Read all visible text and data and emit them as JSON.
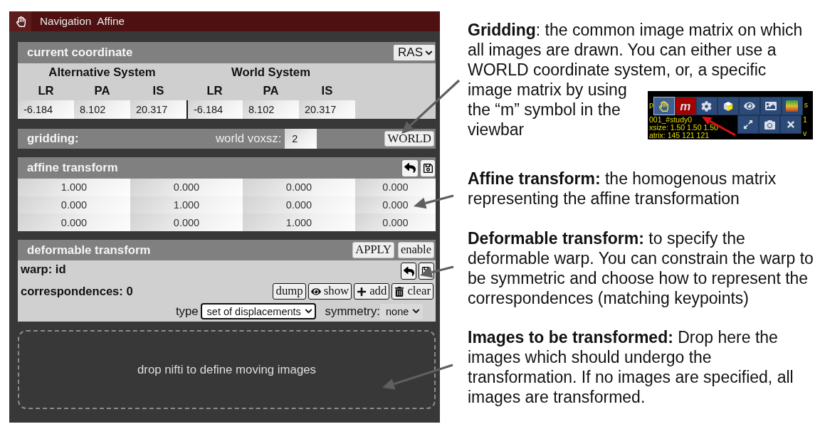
{
  "panel": {
    "tabs": [
      {
        "label": "Navigation"
      },
      {
        "label": "Affine"
      }
    ],
    "current_coordinate": {
      "title": "current coordinate",
      "orientation": "RAS",
      "groups": [
        "Alternative System",
        "World System"
      ],
      "axes": [
        "LR",
        "PA",
        "IS",
        "LR",
        "PA",
        "IS"
      ],
      "values": [
        "-6.184",
        "8.102",
        "20.317",
        "-6.184",
        "8.102",
        "20.317"
      ]
    },
    "gridding": {
      "title": "gridding:",
      "voxsz_label": "world voxsz:",
      "voxsz": "2",
      "button": "WORLD"
    },
    "affine_transform": {
      "title": "affine transform",
      "matrix": [
        [
          "1.000",
          "0.000",
          "0.000",
          "0.000"
        ],
        [
          "0.000",
          "1.000",
          "0.000",
          "0.000"
        ],
        [
          "0.000",
          "0.000",
          "1.000",
          "0.000"
        ]
      ]
    },
    "deformable_transform": {
      "title": "deformable transform",
      "buttons": [
        "APPLY",
        "enable"
      ],
      "warp": "warp: id",
      "correspondences": "correspondences: 0",
      "actions": [
        {
          "kind": "dump",
          "label": "dump"
        },
        {
          "kind": "show",
          "label": "show"
        },
        {
          "kind": "add",
          "label": "add"
        },
        {
          "kind": "clear",
          "label": "clear"
        }
      ],
      "type_label": "type",
      "type_value": "set of displacements",
      "symmetry_label": "symmetry:",
      "symmetry_value": "none"
    },
    "drop_zone": "drop nifti to define moving images"
  },
  "annotations": [
    {
      "text": "**Gridding**: the common image matrix on which all images are drawn. You can either use a WORLD coordinate system, or, a specific",
      "text_beside_inset": "image matrix by using the “m” symbol in the viewbar",
      "inset": {
        "info_lines": [
          "p",
          "001_#study0",
          "xsize: 1.50 1.50 1.50",
          "atrix: 145 121 121"
        ],
        "edge_lines": [
          "s",
          "1",
          "v"
        ],
        "tool_rows": [
          [
            {
              "kind": "hand",
              "selected": true
            },
            {
              "kind": "letter",
              "label": "m",
              "selected": false
            },
            {
              "kind": "gear",
              "selected": false
            },
            {
              "kind": "cube",
              "selected": false
            },
            {
              "kind": "eye",
              "selected": false
            },
            {
              "kind": "image",
              "selected": false
            },
            {
              "kind": "colorbar",
              "selected": false
            }
          ],
          [
            {
              "kind": "expand",
              "selected": false
            },
            {
              "kind": "camera",
              "selected": false
            },
            {
              "kind": "close",
              "selected": false
            }
          ]
        ]
      }
    },
    {
      "text": "**Affine transform:** the homogenous matrix representing the affine transformation"
    },
    {
      "text": "**Deformable transform:** to specify the deformable warp. You can constrain the warp to be symmetric and choose how to represent the correspondences (matching keypoints)"
    },
    {
      "text": "**Images to be transformed:** Drop here the images which should undergo the transformation. If no images are specified, all images are transformed."
    }
  ]
}
